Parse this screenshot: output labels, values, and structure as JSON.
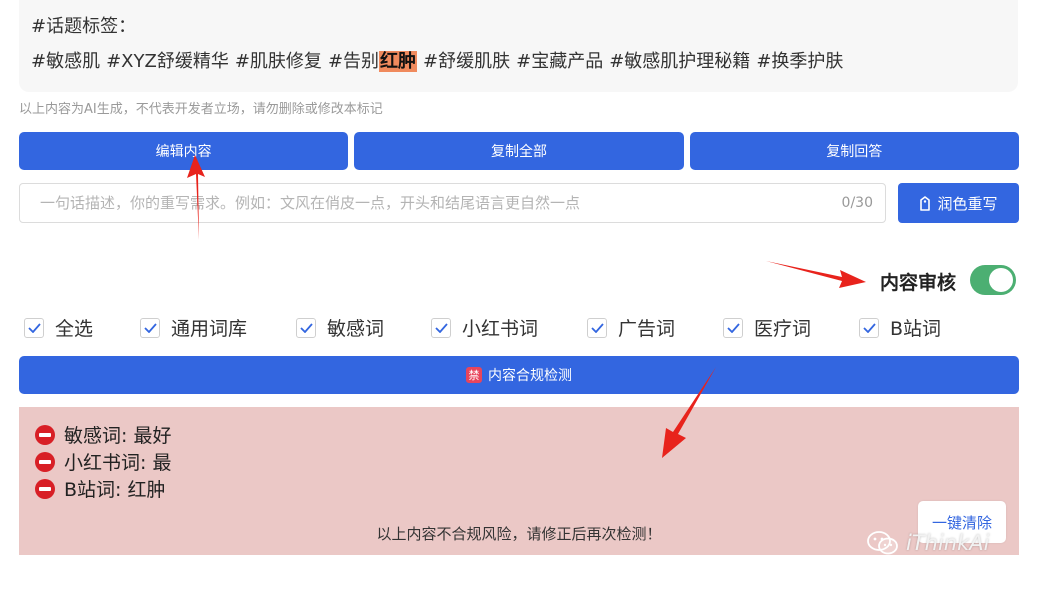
{
  "tags": {
    "title": "#话题标签：",
    "items": [
      "#敏感肌",
      "#XYZ舒缓精华",
      "#肌肤修复"
    ],
    "tag_prefix": "#告别",
    "tag_highlight": "红肿",
    "items_after": [
      "#舒缓肌肤",
      "#宝藏产品",
      "#敏感肌护理秘籍",
      "#换季护肤"
    ]
  },
  "disclaimer": "以上内容为AI生成，不代表开发者立场，请勿删除或修改本标记",
  "actions": {
    "edit": "编辑内容",
    "copy_all": "复制全部",
    "copy_answer": "复制回答"
  },
  "rewrite": {
    "placeholder": "一句话描述，你的重写需求。例如：文风在俏皮一点，开头和结尾语言更自然一点",
    "value": "",
    "counter": "0/30",
    "button": "润色重写",
    "button_icon": "tag-icon"
  },
  "review": {
    "label": "内容审核",
    "enabled": true
  },
  "filters": [
    {
      "label": "全选",
      "checked": true
    },
    {
      "label": "通用词库",
      "checked": true
    },
    {
      "label": "敏感词",
      "checked": true
    },
    {
      "label": "小红书词",
      "checked": true
    },
    {
      "label": "广告词",
      "checked": true
    },
    {
      "label": "医疗词",
      "checked": true
    },
    {
      "label": "B站词",
      "checked": true
    }
  ],
  "detect": {
    "icon_text": "禁",
    "label": "内容合规检测"
  },
  "result": {
    "items": [
      "敏感词: 最好",
      "小红书词: 最",
      "B站词: 红肿"
    ],
    "message": "以上内容不合规风险，请修正后再次检测！",
    "clear": "一键清除"
  },
  "watermark": "iThinkAi",
  "colors": {
    "primary": "#3366e0",
    "toggle_on": "#4caf72",
    "result_bg": "#ebc8c6",
    "stop_red": "#d81f26",
    "highlight": "#f08a5d",
    "arrow_red": "#e8231c"
  }
}
